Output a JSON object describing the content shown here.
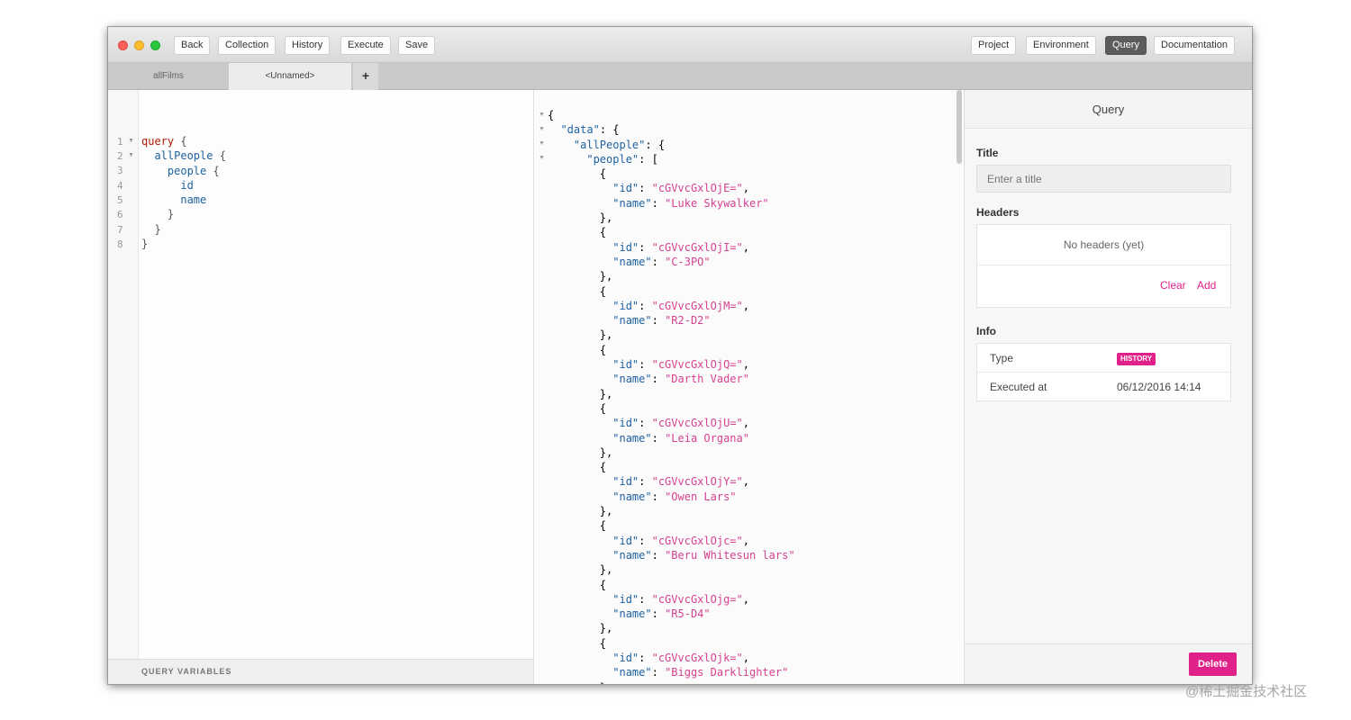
{
  "window": {
    "colors": {
      "close": "#fc5f57",
      "minimize": "#fdbc2e",
      "maximize": "#28c840",
      "accent": "#e0218a"
    }
  },
  "toolbar": {
    "left_buttons": [
      "Back",
      "Collection",
      "History",
      "Execute",
      "Save"
    ],
    "right_buttons": [
      "Project",
      "Environment",
      "Query",
      "Documentation"
    ],
    "active_right": "Query"
  },
  "tabs": {
    "items": [
      "allFilms",
      "<Unnamed>"
    ],
    "active": "<Unnamed>",
    "add_label": "+"
  },
  "editor": {
    "line_numbers": [
      "1",
      "2",
      "3",
      "4",
      "5",
      "6",
      "7",
      "8"
    ],
    "keyword_query": "query",
    "brace_open": "{",
    "field_allPeople": "allPeople",
    "field_people": "people",
    "field_id": "id",
    "field_name": "name",
    "brace_close": "}",
    "variables_label": "QUERY VARIABLES"
  },
  "result": {
    "key_data": "\"data\"",
    "key_allPeople": "\"allPeople\"",
    "key_people": "\"people\"",
    "key_id": "\"id\"",
    "key_name": "\"name\"",
    "people": [
      {
        "id": "\"cGVvcGxlOjE=\"",
        "name": "\"Luke Skywalker\""
      },
      {
        "id": "\"cGVvcGxlOjI=\"",
        "name": "\"C-3PO\""
      },
      {
        "id": "\"cGVvcGxlOjM=\"",
        "name": "\"R2-D2\""
      },
      {
        "id": "\"cGVvcGxlOjQ=\"",
        "name": "\"Darth Vader\""
      },
      {
        "id": "\"cGVvcGxlOjU=\"",
        "name": "\"Leia Organa\""
      },
      {
        "id": "\"cGVvcGxlOjY=\"",
        "name": "\"Owen Lars\""
      },
      {
        "id": "\"cGVvcGxlOjc=\"",
        "name": "\"Beru Whitesun lars\""
      },
      {
        "id": "\"cGVvcGxlOjg=\"",
        "name": "\"R5-D4\""
      },
      {
        "id": "\"cGVvcGxlOjk=\"",
        "name": "\"Biggs Darklighter\""
      }
    ]
  },
  "panel": {
    "header": "Query",
    "title_label": "Title",
    "title_placeholder": "Enter a title",
    "headers_label": "Headers",
    "no_headers": "No headers (yet)",
    "clear_label": "Clear",
    "add_label": "Add",
    "info_label": "Info",
    "type_key": "Type",
    "type_value": "HISTORY",
    "executed_key": "Executed at",
    "executed_value": "06/12/2016 14:14",
    "delete_label": "Delete"
  },
  "watermark": "@稀土掘金技术社区"
}
